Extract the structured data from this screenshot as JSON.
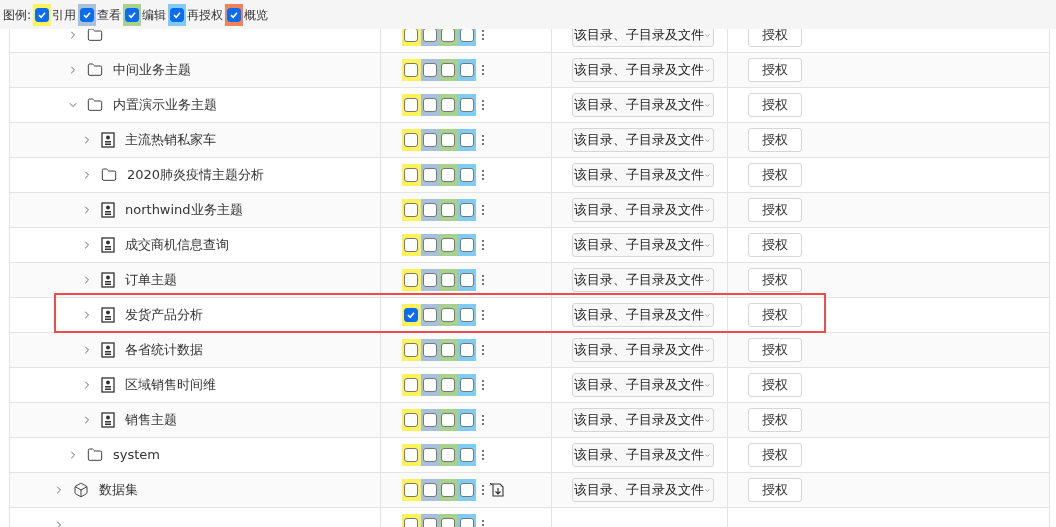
{
  "legend": {
    "label": "图例:",
    "items": [
      {
        "label": "引用",
        "color": "#fdf25a",
        "checked": true
      },
      {
        "label": "查看",
        "color": "#a7c0dc",
        "checked": true
      },
      {
        "label": "编辑",
        "color": "#a8d18d",
        "checked": true
      },
      {
        "label": "再授权",
        "color": "#7fcbf1",
        "checked": true
      },
      {
        "label": "概览",
        "color": "#f0835a",
        "checked": true
      }
    ]
  },
  "tree": [
    {
      "kind": "hidden",
      "children": [
        {
          "kind": "folder",
          "expanded": false,
          "perms": [
            false,
            false,
            false,
            false
          ],
          "scope": "该目录、子目录及文件",
          "button": "授权",
          "highlighted": false,
          "import_icon": false
        },
        {
          "kind": "folder",
          "name": "中间业务主题",
          "expanded": false,
          "perms": [
            false,
            false,
            false,
            false
          ],
          "scope": "该目录、子目录及文件",
          "button": "授权",
          "highlighted": false,
          "import_icon": false
        },
        {
          "kind": "folder",
          "name": "内置演示业务主题",
          "expanded": true,
          "perms": [
            false,
            false,
            false,
            false
          ],
          "scope": "该目录、子目录及文件",
          "button": "授权",
          "highlighted": false,
          "import_icon": false,
          "children": [
            {
              "kind": "report",
              "name": "主流热销私家车",
              "expanded": false,
              "perms": [
                false,
                false,
                false,
                false
              ],
              "scope": "该目录、子目录及文件",
              "button": "授权",
              "highlighted": false,
              "import_icon": false
            },
            {
              "kind": "folder",
              "name": "2020肺炎疫情主题分析",
              "expanded": false,
              "perms": [
                false,
                false,
                false,
                false
              ],
              "scope": "该目录、子目录及文件",
              "button": "授权",
              "highlighted": false,
              "import_icon": false
            },
            {
              "kind": "report",
              "name": "northwind业务主题",
              "expanded": false,
              "perms": [
                false,
                false,
                false,
                false
              ],
              "scope": "该目录、子目录及文件",
              "button": "授权",
              "highlighted": false,
              "import_icon": false
            },
            {
              "kind": "report",
              "name": "成交商机信息查询",
              "expanded": false,
              "perms": [
                false,
                false,
                false,
                false
              ],
              "scope": "该目录、子目录及文件",
              "button": "授权",
              "highlighted": false,
              "import_icon": false
            },
            {
              "kind": "report",
              "name": "订单主题",
              "expanded": false,
              "perms": [
                false,
                false,
                false,
                false
              ],
              "scope": "该目录、子目录及文件",
              "button": "授权",
              "highlighted": false,
              "import_icon": false
            },
            {
              "kind": "report",
              "name": "发货产品分析",
              "expanded": false,
              "perms": [
                true,
                false,
                false,
                false
              ],
              "scope": "该目录、子目录及文件",
              "button": "授权",
              "highlighted": true,
              "import_icon": false
            },
            {
              "kind": "report",
              "name": "各省统计数据",
              "expanded": false,
              "perms": [
                false,
                false,
                false,
                false
              ],
              "scope": "该目录、子目录及文件",
              "button": "授权",
              "highlighted": false,
              "import_icon": false
            },
            {
              "kind": "report",
              "name": "区域销售时间维",
              "expanded": false,
              "perms": [
                false,
                false,
                false,
                false
              ],
              "scope": "该目录、子目录及文件",
              "button": "授权",
              "highlighted": false,
              "import_icon": false
            },
            {
              "kind": "report",
              "name": "销售主题",
              "expanded": false,
              "perms": [
                false,
                false,
                false,
                false
              ],
              "scope": "该目录、子目录及文件",
              "button": "授权",
              "highlighted": false,
              "import_icon": false
            }
          ]
        },
        {
          "kind": "folder",
          "name": "system",
          "expanded": false,
          "perms": [
            false,
            false,
            false,
            false
          ],
          "scope": "该目录、子目录及文件",
          "button": "授权",
          "highlighted": false,
          "import_icon": false
        }
      ]
    },
    {
      "kind": "dataset",
      "name": "数据集",
      "expanded": false,
      "perms": [
        false,
        false,
        false,
        false
      ],
      "scope": "该目录、子目录及文件",
      "button": "授权",
      "highlighted": false,
      "import_icon": true
    },
    {
      "kind": "partial",
      "expanded": false,
      "perms": [
        false,
        false,
        false,
        false
      ],
      "highlighted": false,
      "import_icon": false
    }
  ]
}
